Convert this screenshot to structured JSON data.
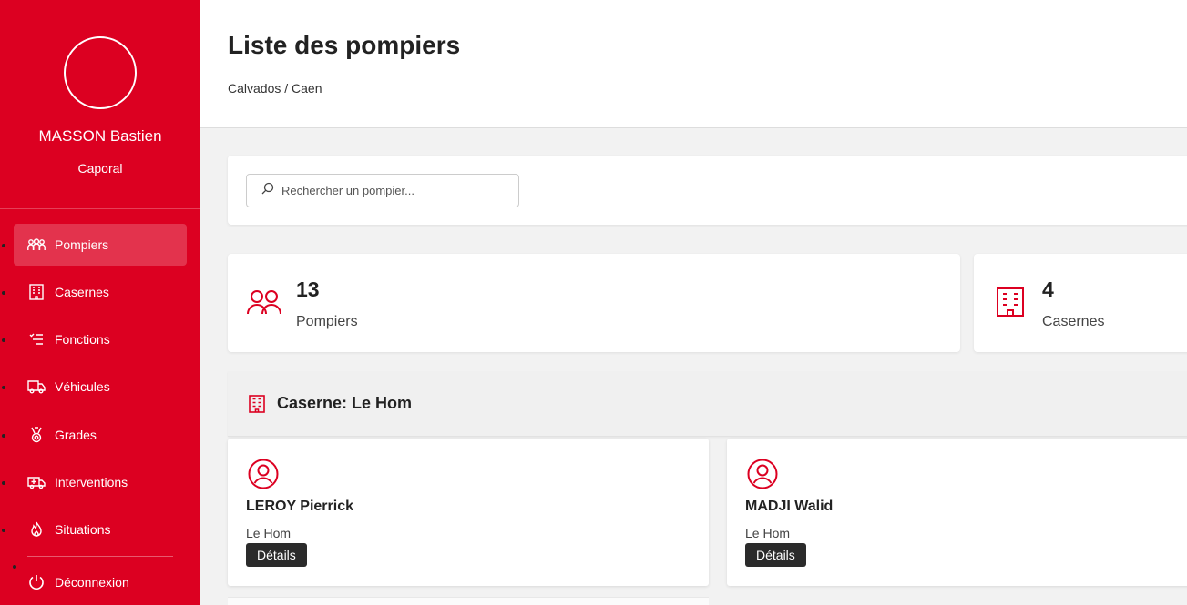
{
  "colors": {
    "brand": "#dc0021",
    "dark_button": "#2b2b2b"
  },
  "user": {
    "name": "MASSON Bastien",
    "rank": "Caporal"
  },
  "sidebar": {
    "items": [
      {
        "label": "Pompiers",
        "icon": "firefighters-icon",
        "active": true
      },
      {
        "label": "Casernes",
        "icon": "building-icon"
      },
      {
        "label": "Fonctions",
        "icon": "list-icon"
      },
      {
        "label": "Véhicules",
        "icon": "truck-icon"
      },
      {
        "label": "Grades",
        "icon": "medal-icon"
      },
      {
        "label": "Interventions",
        "icon": "ambulance-icon"
      },
      {
        "label": "Situations",
        "icon": "fire-icon"
      }
    ],
    "logout": {
      "label": "Déconnexion",
      "icon": "power-icon"
    }
  },
  "header": {
    "title": "Liste des pompiers",
    "breadcrumb": "Calvados / Caen"
  },
  "search": {
    "placeholder": "Rechercher un pompier..."
  },
  "stats": [
    {
      "value": "13",
      "label": "Pompiers",
      "icon": "users-icon"
    },
    {
      "value": "4",
      "label": "Casernes",
      "icon": "building-icon"
    }
  ],
  "caserne": {
    "title": "Caserne: Le Hom",
    "pompiers": [
      {
        "name": "LEROY Pierrick",
        "caserne": "Le Hom",
        "button": "Détails"
      },
      {
        "name": "MADJI Walid",
        "caserne": "Le Hom",
        "button": "Détails"
      }
    ]
  }
}
